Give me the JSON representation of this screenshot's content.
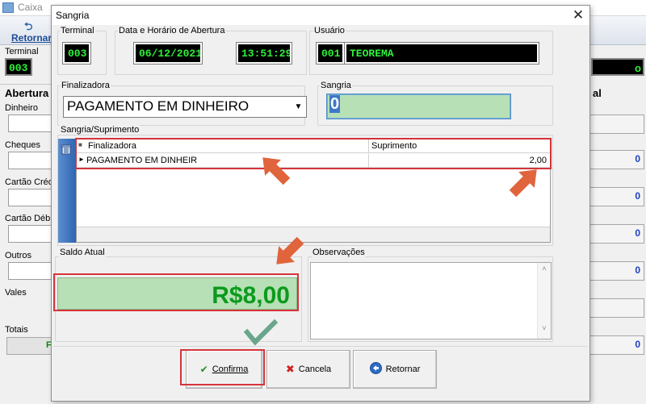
{
  "background_window": {
    "title": "Caixa",
    "toolbar_button": "Retornar",
    "terminal_label": "Terminal",
    "terminal_value": "003",
    "right_display_suffix": "o",
    "section_title": "Abertura",
    "section_title_right": "al",
    "fields": [
      "Dinheiro",
      "Cheques",
      "Cartão Crédi",
      "Cartão Débit",
      "Outros",
      "Vales",
      "Totais"
    ],
    "right_values": [
      "0",
      "0",
      "0",
      "0",
      "0"
    ],
    "totals_right": "0",
    "totals_left": "F"
  },
  "dialog": {
    "title": "Sangria",
    "terminal": {
      "label": "Terminal",
      "value": "003"
    },
    "opening": {
      "label": "Data e Horário de Abertura",
      "date": "06/12/2021",
      "time": "13:51:29"
    },
    "user": {
      "label": "Usuário",
      "code": "001",
      "name": "TEOREMA"
    },
    "finalizadora": {
      "label": "Finalizadora",
      "selected": "PAGAMENTO EM DINHEIRO"
    },
    "sangria": {
      "label": "Sangria",
      "value": "0"
    },
    "grid": {
      "group_label": "Sangria/Suprimento",
      "columns": [
        "Finalizadora",
        "Suprimento"
      ],
      "rows": [
        {
          "finalizadora": "PAGAMENTO EM DINHEIR",
          "suprimento": "2,00"
        }
      ]
    },
    "saldo": {
      "label": "Saldo Atual",
      "value": "R$8,00"
    },
    "observacoes": {
      "label": "Observações",
      "value": ""
    },
    "buttons": {
      "confirm": "Confirma",
      "cancel": "Cancela",
      "back": "Retornar"
    }
  },
  "colors": {
    "lcd_background": "#000000",
    "lcd_text": "#2ef23a",
    "saldo_fill": "#b7e0b7",
    "saldo_text": "#0c9a1c",
    "annotation_red": "#d4343a",
    "annotation_arrow": "#e0643c",
    "annotation_check": "#6aa68c"
  },
  "icons": {
    "close": "close-icon",
    "dropdown": "chevron-down-icon",
    "grid": "trash-icon",
    "confirm": "checkmark-icon",
    "cancel": "x-icon",
    "back": "back-arrow-icon"
  }
}
